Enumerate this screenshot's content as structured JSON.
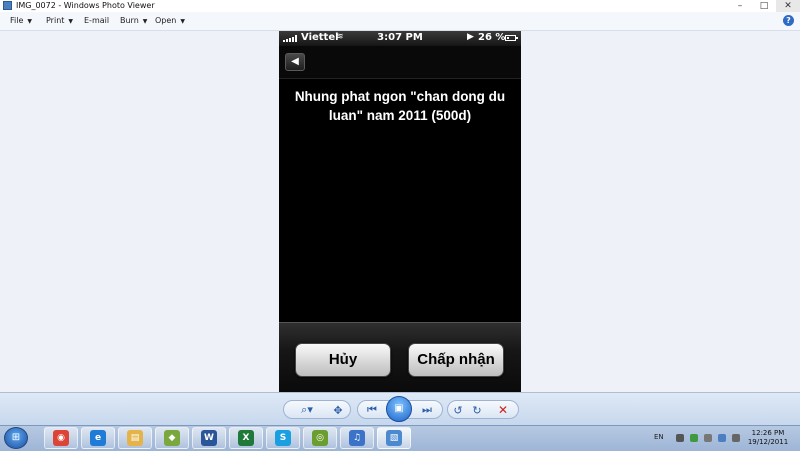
{
  "window": {
    "title": "IMG_0072 - Windows Photo Viewer",
    "controls": {
      "minimize": "–",
      "maximize": "□",
      "close": "✕"
    }
  },
  "menu": {
    "items": [
      {
        "label": "File",
        "has_arrow": true
      },
      {
        "label": "Print",
        "has_arrow": true
      },
      {
        "label": "E-mail",
        "has_arrow": false
      },
      {
        "label": "Burn",
        "has_arrow": true
      },
      {
        "label": "Open",
        "has_arrow": true
      }
    ],
    "arrow": "▼",
    "help": "?"
  },
  "phone": {
    "status": {
      "carrier": "Viettel",
      "time": "3:07 PM",
      "battery": "26 %",
      "battery_level": 0.26
    },
    "nav": {
      "back_glyph": "◀"
    },
    "message": "Nhung phat ngon \"chan dong du luan\" nam 2011 (500d)",
    "buttons": {
      "cancel": "Hủy",
      "accept": "Chấp nhận"
    }
  },
  "controls": {
    "zoom": "⌕▾",
    "fit": "✥",
    "previous": "⏮",
    "slideshow": "▣",
    "next": "⏭",
    "rotate_left": "↺",
    "rotate_right": "↻",
    "delete": "✕"
  },
  "taskbar": {
    "start_glyph": "⊞",
    "apps": [
      {
        "name": "chrome",
        "glyph": "◉",
        "color": "#db4437"
      },
      {
        "name": "internet-explorer",
        "glyph": "e",
        "color": "#1e7bd6"
      },
      {
        "name": "explorer",
        "glyph": "▤",
        "color": "#e4b44a"
      },
      {
        "name": "picture-app",
        "glyph": "◆",
        "color": "#7aa83c"
      },
      {
        "name": "word",
        "glyph": "W",
        "color": "#2a5699"
      },
      {
        "name": "excel",
        "glyph": "X",
        "color": "#1f7a3a"
      },
      {
        "name": "skype",
        "glyph": "S",
        "color": "#1aa0e0"
      },
      {
        "name": "media-disc",
        "glyph": "◎",
        "color": "#6a9e2f"
      },
      {
        "name": "itunes",
        "glyph": "♫",
        "color": "#3b73c8"
      },
      {
        "name": "photo-viewer",
        "glyph": "▧",
        "color": "#4c8ad0"
      }
    ],
    "tray": {
      "language": "EN",
      "time": "12:26 PM",
      "date": "19/12/2011"
    }
  }
}
